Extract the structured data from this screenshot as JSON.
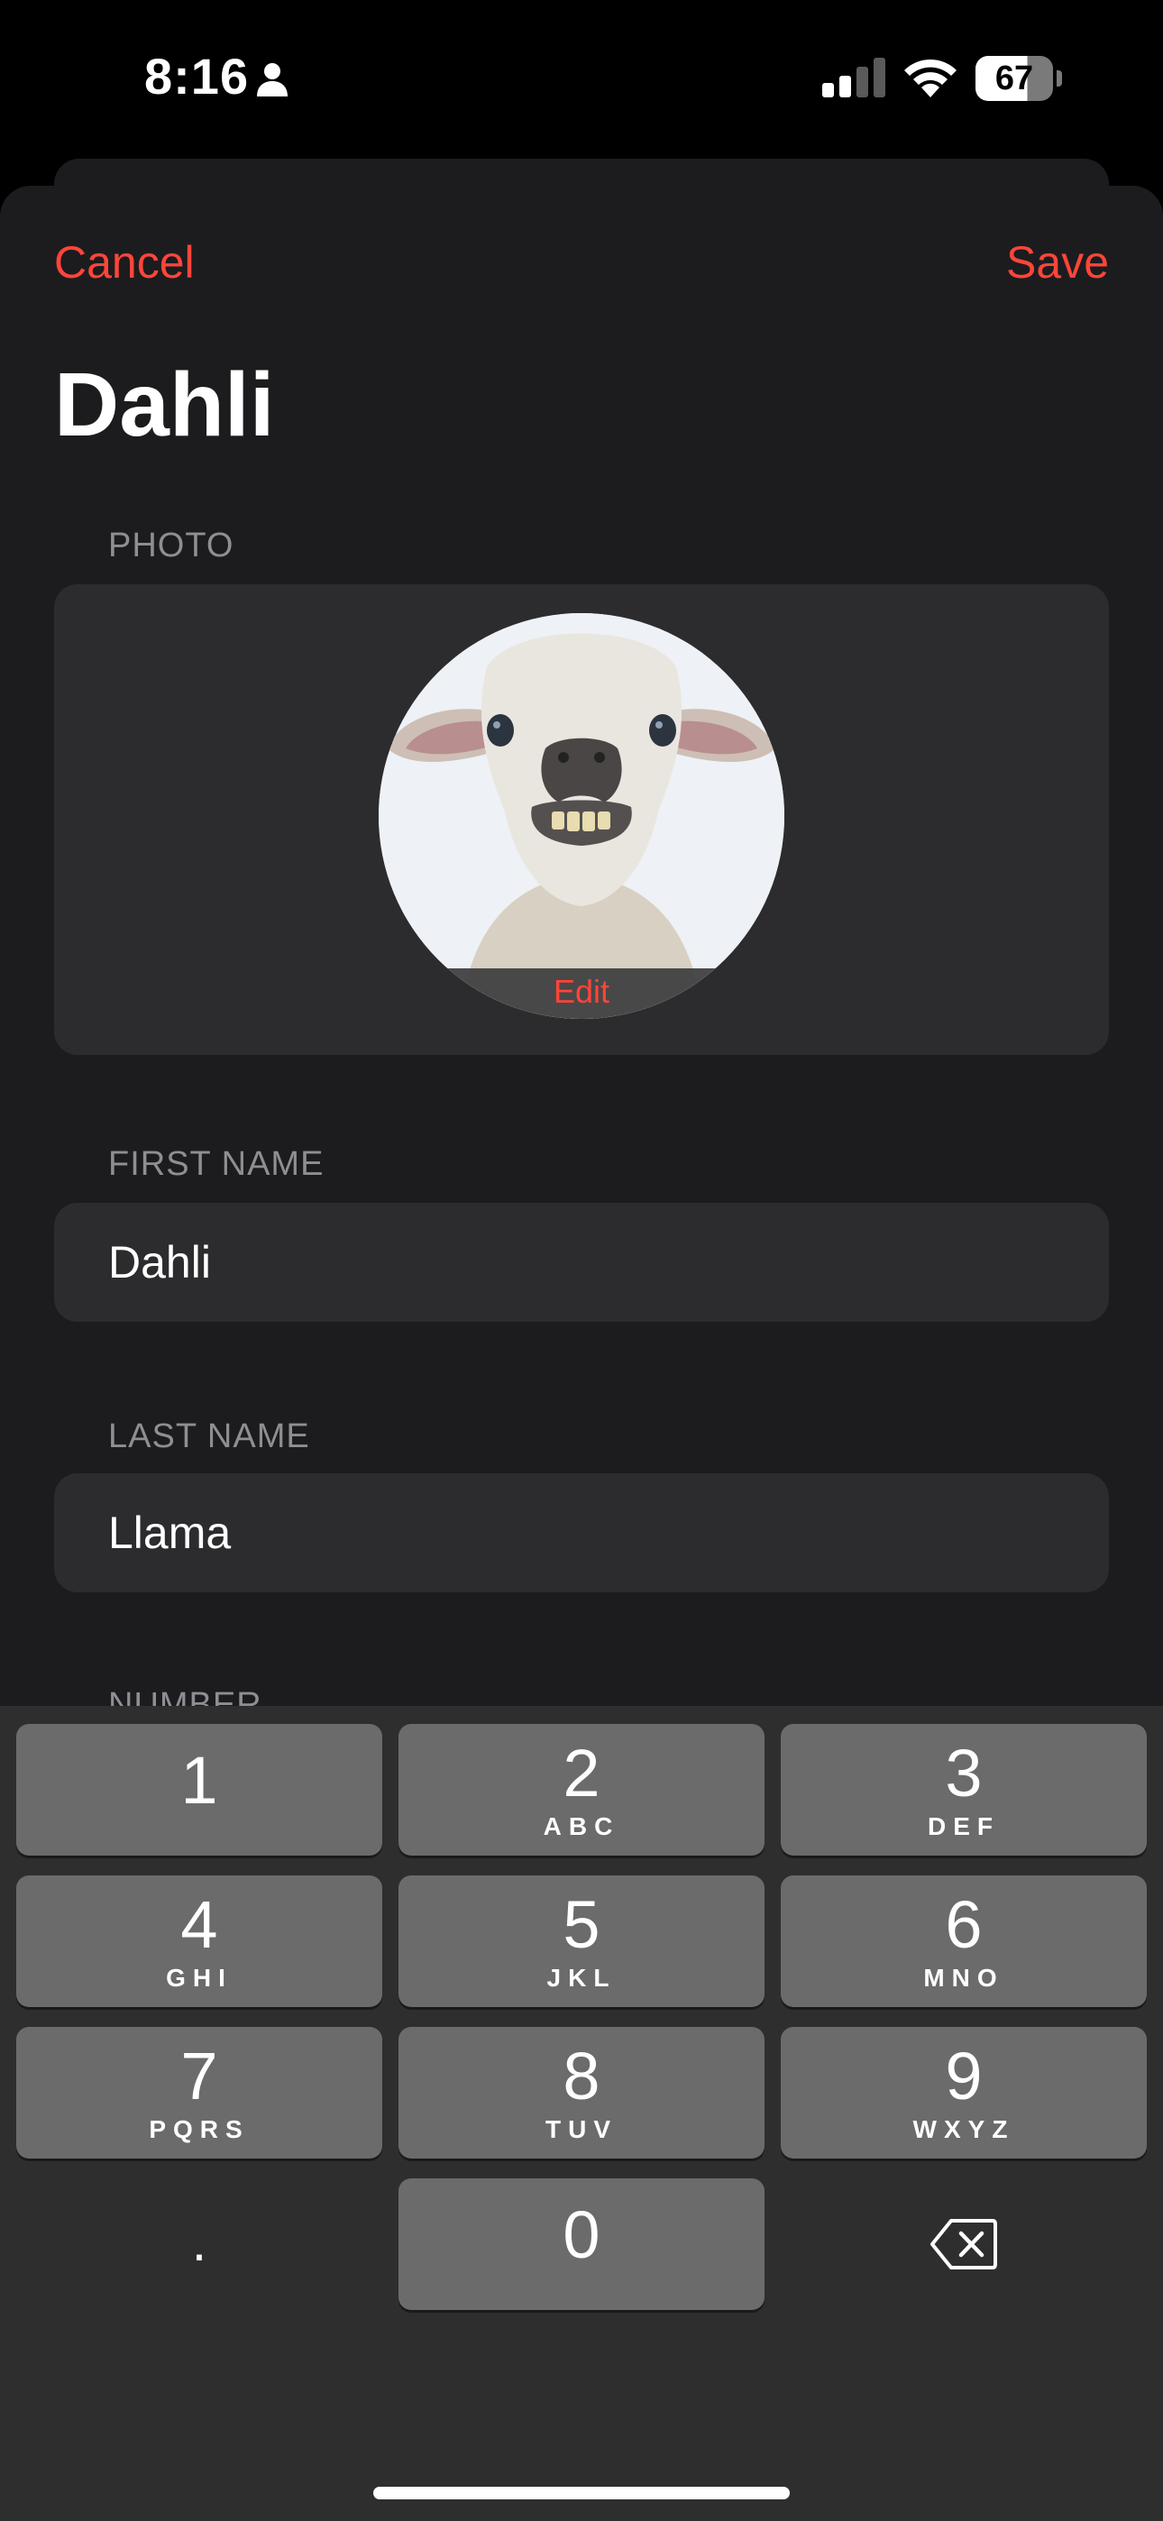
{
  "status_bar": {
    "time": "8:16",
    "battery": "67",
    "battery_level": 0.67,
    "icons": [
      "person-icon",
      "cellular-signal-icon",
      "wifi-icon",
      "battery-icon"
    ]
  },
  "nav": {
    "cancel_label": "Cancel",
    "save_label": "Save",
    "accent_color": "#ff453a"
  },
  "title": "Dahli",
  "photo": {
    "section_label": "PHOTO",
    "edit_label": "Edit"
  },
  "fields": [
    {
      "label": "FIRST NAME",
      "value": "Dahli"
    },
    {
      "label": "LAST NAME",
      "value": "Llama"
    },
    {
      "label": "NUMBER"
    }
  ],
  "keyboard": {
    "keys": [
      {
        "num": "1",
        "letters": ""
      },
      {
        "num": "2",
        "letters": "ABC"
      },
      {
        "num": "3",
        "letters": "DEF"
      },
      {
        "num": "4",
        "letters": "GHI"
      },
      {
        "num": "5",
        "letters": "JKL"
      },
      {
        "num": "6",
        "letters": "MNO"
      },
      {
        "num": "7",
        "letters": "PQRS"
      },
      {
        "num": "8",
        "letters": "TUV"
      },
      {
        "num": "9",
        "letters": "WXYZ"
      },
      {
        "num": "0",
        "letters": ""
      }
    ],
    "dot": ".",
    "delete_icon": "backspace-icon"
  }
}
